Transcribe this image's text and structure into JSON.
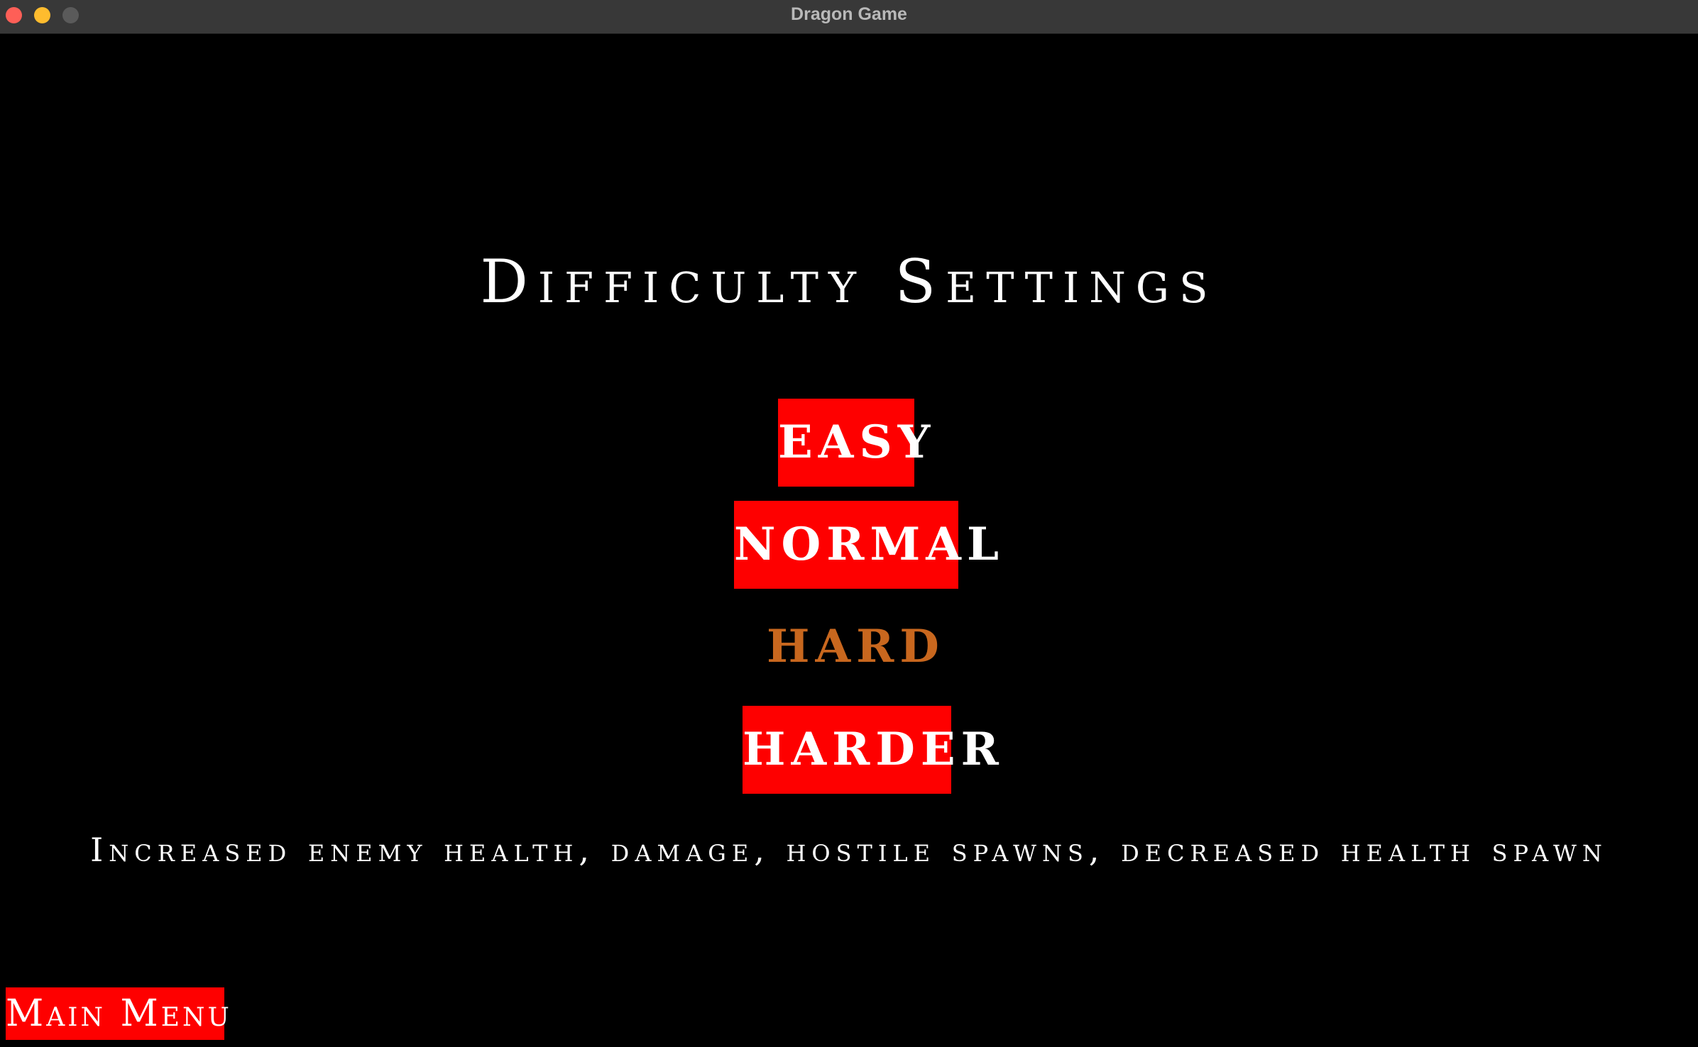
{
  "window": {
    "title": "Dragon Game"
  },
  "screen": {
    "heading": "Difficulty Settings",
    "options": [
      {
        "label": "EASY",
        "state": "button"
      },
      {
        "label": "NORMAL",
        "state": "button"
      },
      {
        "label": "HARD",
        "state": "selected"
      },
      {
        "label": "HARDER",
        "state": "button"
      }
    ],
    "description": "Increased enemy health, damage, hostile spawns, decreased health spawn",
    "main_menu_label": "Main Menu"
  },
  "colors": {
    "background": "#000000",
    "button": "#fe0000",
    "selected_text": "#c8671e",
    "text": "#ffffff"
  }
}
